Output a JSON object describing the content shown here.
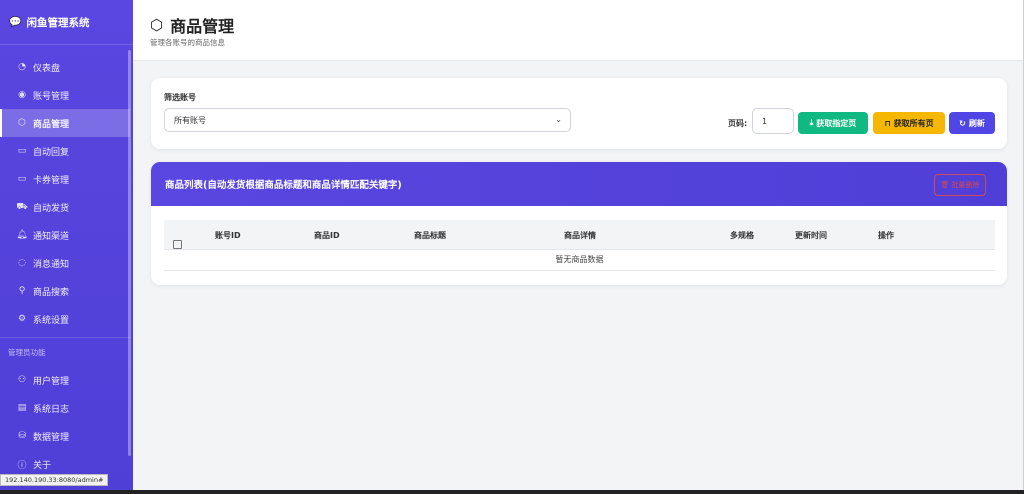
{
  "brand": {
    "icon": "chat-icon",
    "title": "闲鱼管理系统"
  },
  "nav": {
    "items": [
      {
        "icon": "dashboard-icon",
        "label": "仪表盘"
      },
      {
        "icon": "user-circle-icon",
        "label": "账号管理"
      },
      {
        "icon": "box-icon",
        "label": "商品管理"
      },
      {
        "icon": "message-icon",
        "label": "自动回复"
      },
      {
        "icon": "card-icon",
        "label": "卡券管理"
      },
      {
        "icon": "truck-icon",
        "label": "自动发货"
      },
      {
        "icon": "bell-icon",
        "label": "通知渠道"
      },
      {
        "icon": "chat-bubble-icon",
        "label": "消息通知"
      },
      {
        "icon": "search-icon",
        "label": "商品搜索"
      },
      {
        "icon": "gear-icon",
        "label": "系统设置"
      }
    ],
    "admin_section": "管理员功能",
    "admin_items": [
      {
        "icon": "users-icon",
        "label": "用户管理"
      },
      {
        "icon": "log-icon",
        "label": "系统日志"
      },
      {
        "icon": "database-icon",
        "label": "数据管理"
      },
      {
        "icon": "info-icon",
        "label": "关于"
      }
    ],
    "active": "商品管理"
  },
  "status_url": "192.140.190.33:8080/admin#",
  "header": {
    "title": "商品管理",
    "subtitle": "管理各账号的商品信息",
    "icon": "box-icon"
  },
  "filter": {
    "label": "筛选账号",
    "selected": "所有账号",
    "page_label": "页码:",
    "page_value": "1",
    "btn_fetch_page": "获取指定页",
    "btn_fetch_all": "获取所有页",
    "btn_refresh": "刷新"
  },
  "products": {
    "title": "商品列表(自动发货根据商品标题和商品详情匹配关键字)",
    "batch_delete": "批量删除",
    "columns": [
      "账号ID",
      "商品ID",
      "商品标题",
      "商品详情",
      "多规格",
      "更新时间",
      "操作"
    ],
    "empty": "暂无商品数据"
  },
  "colors": {
    "accent": "#4f46e5",
    "green": "#10b981",
    "yellow": "#f5b700",
    "danger": "#e04a4a"
  }
}
